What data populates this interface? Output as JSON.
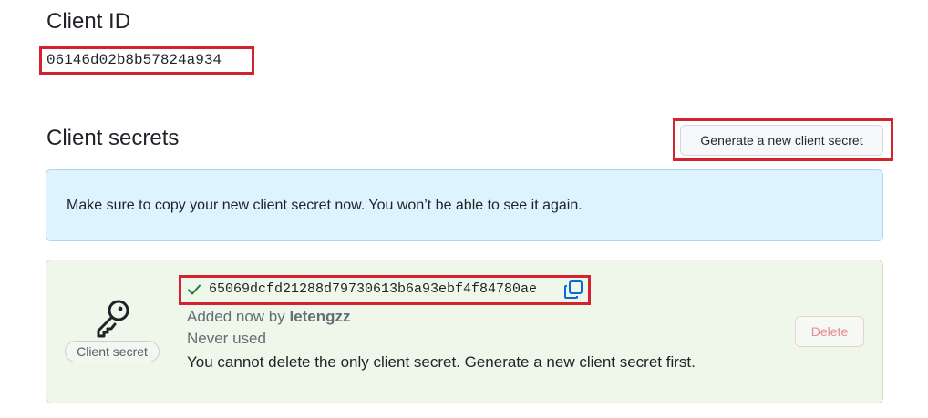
{
  "client_id": {
    "heading": "Client ID",
    "value": "06146d02b8b57824a934"
  },
  "client_secrets": {
    "heading": "Client secrets",
    "generate_button_label": "Generate a new client secret",
    "flash_message": "Make sure to copy your new client secret now. You won’t be able to see it again.",
    "secret": {
      "badge_label": "Client secret",
      "value": "65069dcfd21288d79730613b6a93ebf4f84780ae",
      "added_prefix": "Added now by ",
      "added_user": "letengzz",
      "usage": "Never used",
      "note": "You cannot delete the only client secret. Generate a new client secret first.",
      "delete_label": "Delete",
      "icons": {
        "key": "key-icon",
        "check": "check-icon",
        "copy": "copy-icon"
      }
    }
  },
  "colors": {
    "highlight_border": "#d2232f",
    "flash_bg": "#ddf4ff",
    "secret_box_bg": "#eef7e9",
    "check_green": "#1a7f37",
    "copy_blue": "#0969da",
    "delete_text": "#e58a92"
  }
}
